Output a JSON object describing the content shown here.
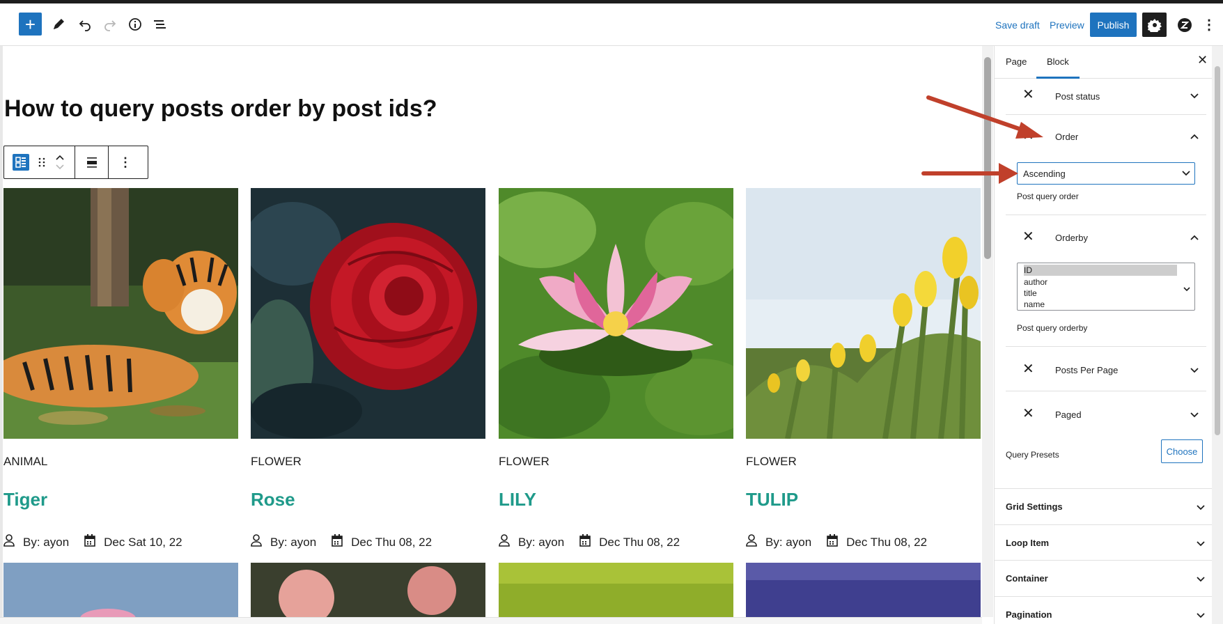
{
  "header": {
    "save_draft": "Save draft",
    "preview": "Preview",
    "publish": "Publish"
  },
  "editor": {
    "title": "How to query posts order by post ids?"
  },
  "posts": [
    {
      "category": "ANIMAL",
      "title": "Tiger",
      "author": "By: ayon",
      "date": "Dec Sat 10, 22"
    },
    {
      "category": "FLOWER",
      "title": "Rose",
      "author": "By: ayon",
      "date": "Dec Thu 08, 22"
    },
    {
      "category": "FLOWER",
      "title": "LILY",
      "author": "By: ayon",
      "date": "Dec Thu 08, 22"
    },
    {
      "category": "FLOWER",
      "title": "TULIP",
      "author": "By: ayon",
      "date": "Dec Thu 08, 22"
    }
  ],
  "sidebar": {
    "tabs": [
      "Page",
      "Block"
    ],
    "active_tab": "Block",
    "post_status_label": "Post status",
    "order_label": "Order",
    "order_value": "Ascending",
    "order_help": "Post query order",
    "orderby_label": "Orderby",
    "orderby_options": [
      "ID",
      "author",
      "title",
      "name"
    ],
    "orderby_selected": "ID",
    "orderby_help": "Post query orderby",
    "posts_per_page_label": "Posts Per Page",
    "paged_label": "Paged",
    "query_presets_label": "Query Presets",
    "choose_label": "Choose",
    "panels": [
      "Grid Settings",
      "Loop Item",
      "Container",
      "Pagination"
    ]
  },
  "colors": {
    "accent": "#1e73be",
    "post_title": "#1f9a8a",
    "annotation_arrow": "#c0402b"
  }
}
